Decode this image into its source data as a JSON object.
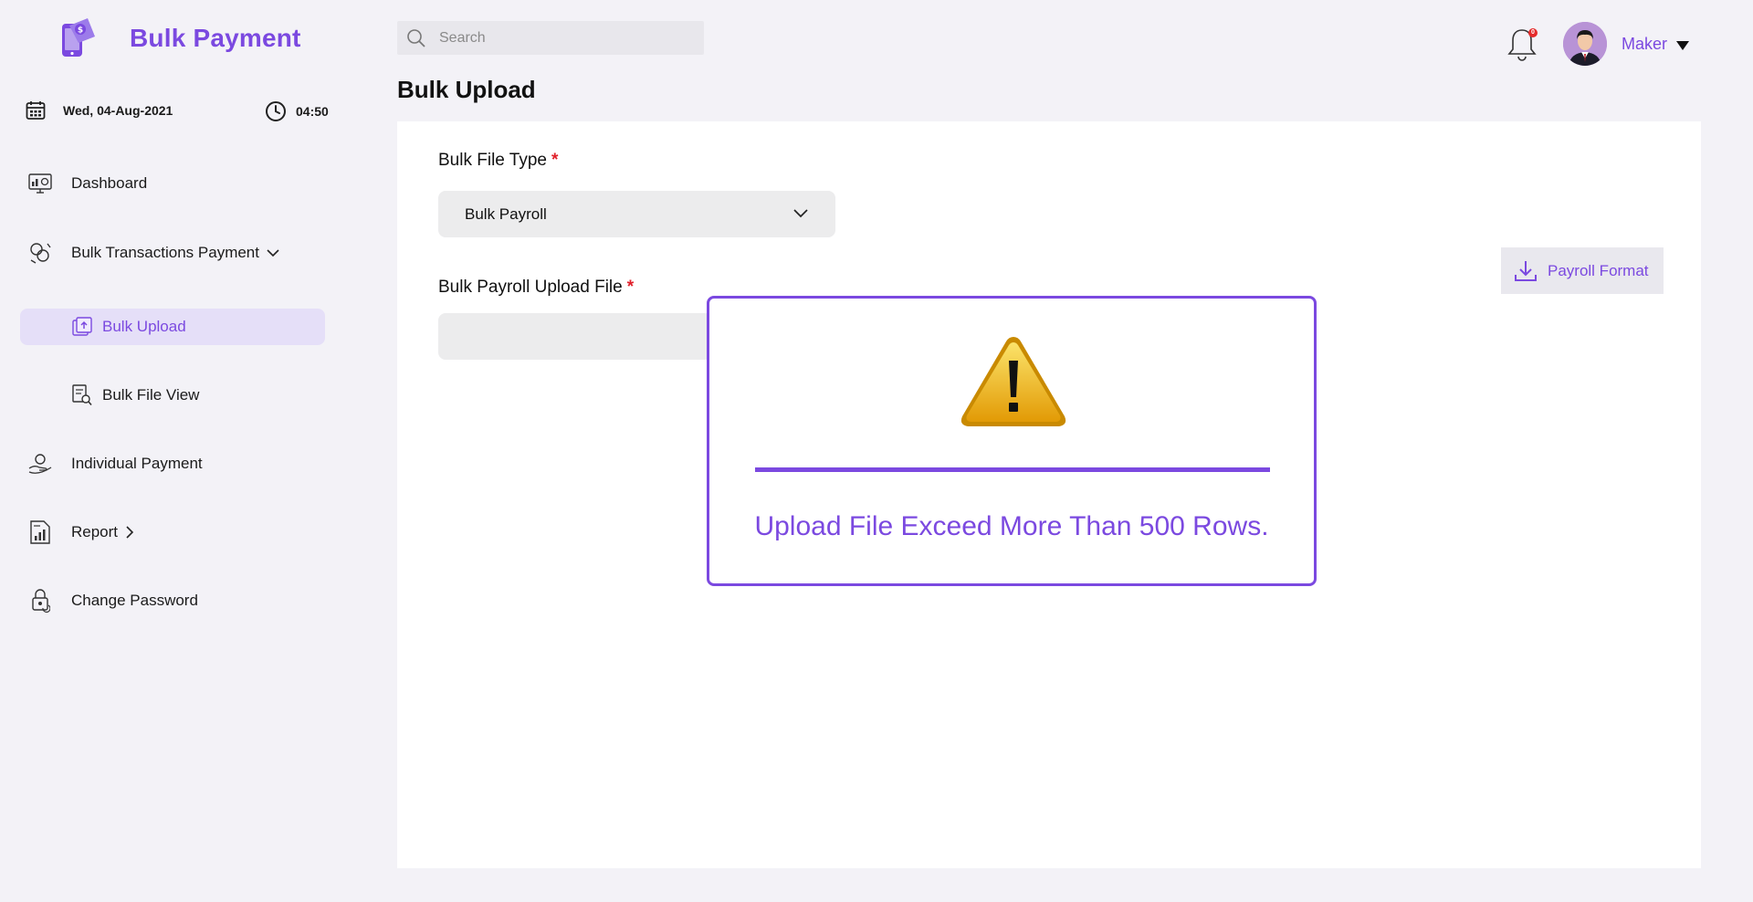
{
  "brand": {
    "title": "Bulk Payment"
  },
  "datetime": {
    "date": "Wed, 04-Aug-2021",
    "time": "04:50"
  },
  "sidebar": {
    "items": [
      {
        "label": "Dashboard",
        "icon": "dashboard-icon"
      },
      {
        "label": "Bulk Transactions Payment",
        "icon": "transactions-icon",
        "expanded": true
      },
      {
        "label": "Bulk Upload",
        "icon": "upload-icon",
        "active": true
      },
      {
        "label": "Bulk File View",
        "icon": "file-view-icon"
      },
      {
        "label": "Individual Payment",
        "icon": "payment-icon"
      },
      {
        "label": "Report",
        "icon": "report-icon"
      },
      {
        "label": "Change Password",
        "icon": "lock-icon"
      }
    ]
  },
  "header": {
    "search_placeholder": "Search",
    "notification_count": "0",
    "user_name": "Maker"
  },
  "page": {
    "title": "Bulk Upload"
  },
  "form": {
    "file_type_label": "Bulk File Type",
    "file_type_value": "Bulk Payroll",
    "upload_label": "Bulk Payroll Upload File",
    "required_mark": "*",
    "format_button": "Payroll Format"
  },
  "modal": {
    "message": "Upload File Exceed More Than 500 Rows."
  },
  "colors": {
    "accent": "#7b49e0",
    "active_bg": "#e5dff8",
    "required": "#e0202a",
    "background": "#f3f2f7"
  }
}
